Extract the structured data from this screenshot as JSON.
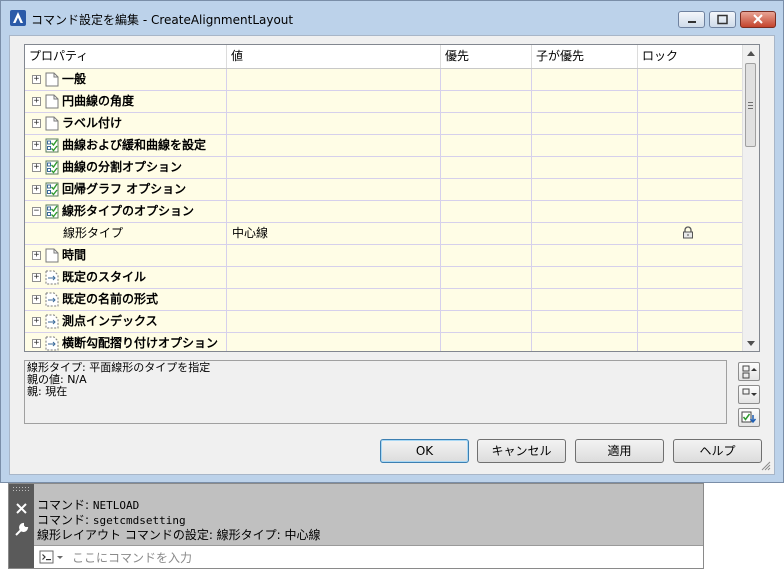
{
  "window": {
    "title": "コマンド設定を編集 - CreateAlignmentLayout"
  },
  "grid": {
    "columns": [
      "プロパティ",
      "値",
      "優先",
      "子が優先",
      "ロック"
    ],
    "rows": [
      {
        "type": "category",
        "expander": "+",
        "icon": "page-icon",
        "label": "一般"
      },
      {
        "type": "category",
        "expander": "+",
        "icon": "page-icon",
        "label": "円曲線の角度"
      },
      {
        "type": "category",
        "expander": "+",
        "icon": "page-icon",
        "label": "ラベル付け"
      },
      {
        "type": "category",
        "expander": "+",
        "icon": "checklist-icon",
        "label": "曲線および緩和曲線を設定"
      },
      {
        "type": "category",
        "expander": "+",
        "icon": "checklist-icon",
        "label": "曲線の分割オプション"
      },
      {
        "type": "category",
        "expander": "+",
        "icon": "checklist-icon",
        "label": "回帰グラフ オプション"
      },
      {
        "type": "category",
        "expander": "−",
        "icon": "checklist-icon",
        "label": "線形タイプのオプション"
      },
      {
        "type": "property",
        "label": "線形タイプ",
        "value": "中心線",
        "lock_icon": "lock-icon"
      },
      {
        "type": "category",
        "expander": "+",
        "icon": "page-icon",
        "label": "時間"
      },
      {
        "type": "category",
        "expander": "+",
        "icon": "dashed-page-icon",
        "label": "既定のスタイル"
      },
      {
        "type": "category",
        "expander": "+",
        "icon": "dashed-page-icon",
        "label": "既定の名前の形式"
      },
      {
        "type": "category",
        "expander": "+",
        "icon": "dashed-page-icon",
        "label": "測点インデックス"
      },
      {
        "type": "category",
        "expander": "+",
        "icon": "dashed-page-icon",
        "label": "横断勾配摺り付けオプション"
      }
    ]
  },
  "description": {
    "line1": "線形タイプ: 平面線形のタイプを指定",
    "line2": "親の値: N/A",
    "line3": "親: 現在"
  },
  "buttons": {
    "ok": "OK",
    "cancel": "キャンセル",
    "apply": "適用",
    "help": "ヘルプ"
  },
  "command_window": {
    "lines": [
      {
        "prefix": "コマンド: ",
        "text": "NETLOAD"
      },
      {
        "prefix": "コマンド: ",
        "text": "sgetcmdsetting"
      },
      {
        "prefix": "線形レイアウト コマンドの設定: 線形タイプ: 中心線",
        "text": ""
      }
    ],
    "placeholder": "ここにコマンドを入力"
  },
  "colors": {
    "grid_background": "#fffde6",
    "row_border": "#d6d0ec",
    "dialog_frame": "#bcd2ea"
  }
}
